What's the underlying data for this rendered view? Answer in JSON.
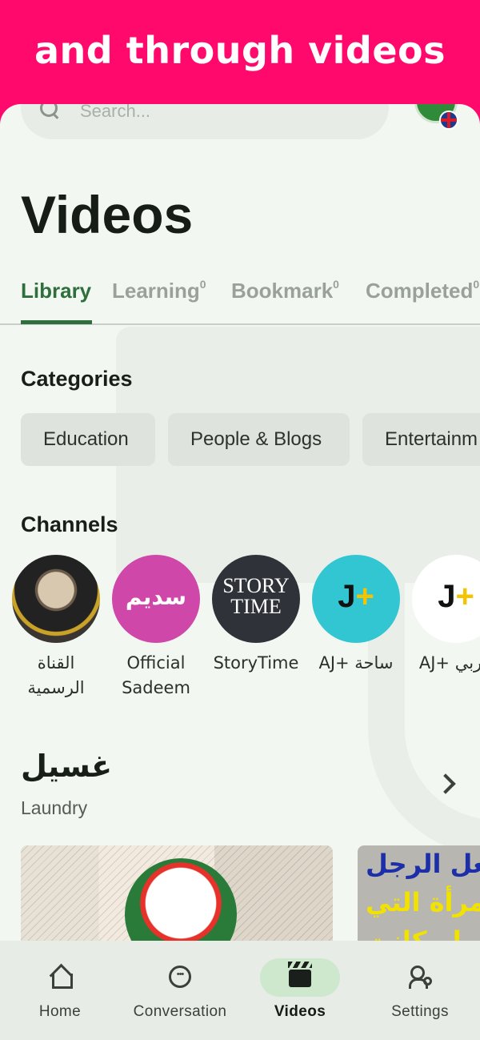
{
  "banner": {
    "title": "and through videos",
    "color": "#ff0a6c"
  },
  "search": {
    "placeholder": "Search..."
  },
  "page": {
    "title": "Videos"
  },
  "tabs": [
    {
      "label": "Library",
      "count": "",
      "active": true
    },
    {
      "label": "Learning",
      "count": "0"
    },
    {
      "label": "Bookmark",
      "count": "0"
    },
    {
      "label": "Completed",
      "count": "0"
    }
  ],
  "categories": {
    "title": "Categories",
    "items": [
      "Education",
      "People & Blogs",
      "Entertainm"
    ]
  },
  "channels": {
    "title": "Channels",
    "items": [
      {
        "name_line1": "القناة",
        "name_line2": "الرسمية"
      },
      {
        "name_line1": "Official",
        "name_line2": "Sadeem",
        "logo_text": "سديم"
      },
      {
        "name_line1": "StoryTime",
        "name_line2": "",
        "logo_line1": "STORY",
        "logo_line2": "TIME"
      },
      {
        "name_line1": "AJ+ ساحة",
        "name_line2": ""
      },
      {
        "name_line1": "AJ+ عربي",
        "name_line2": ""
      }
    ]
  },
  "playlist": {
    "title": "غسيل",
    "subtitle": "Laundry",
    "thumb2_lines": [
      "تجعل الرجل",
      "مرأة التي",
      "لو كانت"
    ]
  },
  "bottom_nav": [
    {
      "label": "Home",
      "icon": "home-icon"
    },
    {
      "label": "Conversation",
      "icon": "chat-icon"
    },
    {
      "label": "Videos",
      "icon": "clapper-icon",
      "active": true
    },
    {
      "label": "Settings",
      "icon": "user-gear-icon"
    }
  ],
  "colors": {
    "accent": "#2f6e3d",
    "background": "#f2f8f1",
    "nav_active": "#cde8cc"
  }
}
